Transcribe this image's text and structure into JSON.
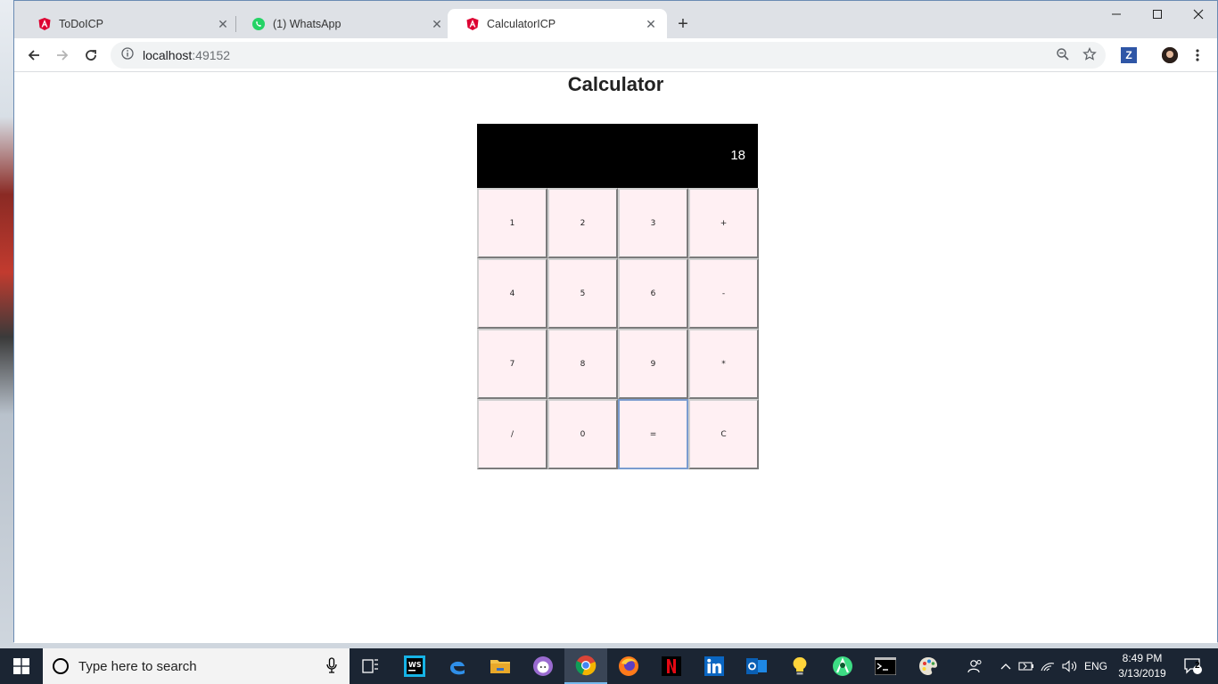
{
  "browser": {
    "tabs": [
      {
        "title": "ToDoICP",
        "icon": "angular-icon",
        "active": false
      },
      {
        "title": "(1) WhatsApp",
        "icon": "whatsapp-icon",
        "active": false
      },
      {
        "title": "CalculatorICP",
        "icon": "angular-icon",
        "active": true
      }
    ],
    "close_glyph": "✕",
    "new_tab_glyph": "+",
    "url_host": "localhost",
    "url_port": ":49152",
    "extension_label": "Z"
  },
  "page": {
    "title": "Calculator",
    "display_value": "18",
    "keys": [
      "1",
      "2",
      "3",
      "+",
      "4",
      "5",
      "6",
      "-",
      "7",
      "8",
      "9",
      "*",
      "/",
      "0",
      "=",
      "C"
    ],
    "focused_key": "="
  },
  "taskbar": {
    "search_placeholder": "Type here to search",
    "language": "ENG",
    "time": "8:49 PM",
    "date": "3/13/2019",
    "notification_count": "2"
  },
  "colors": {
    "display_bg": "#000000",
    "key_bg": "#fff0f3",
    "taskbar_bg": "#1b2533",
    "angular_red": "#dd0031",
    "whatsapp_green": "#25d366"
  }
}
